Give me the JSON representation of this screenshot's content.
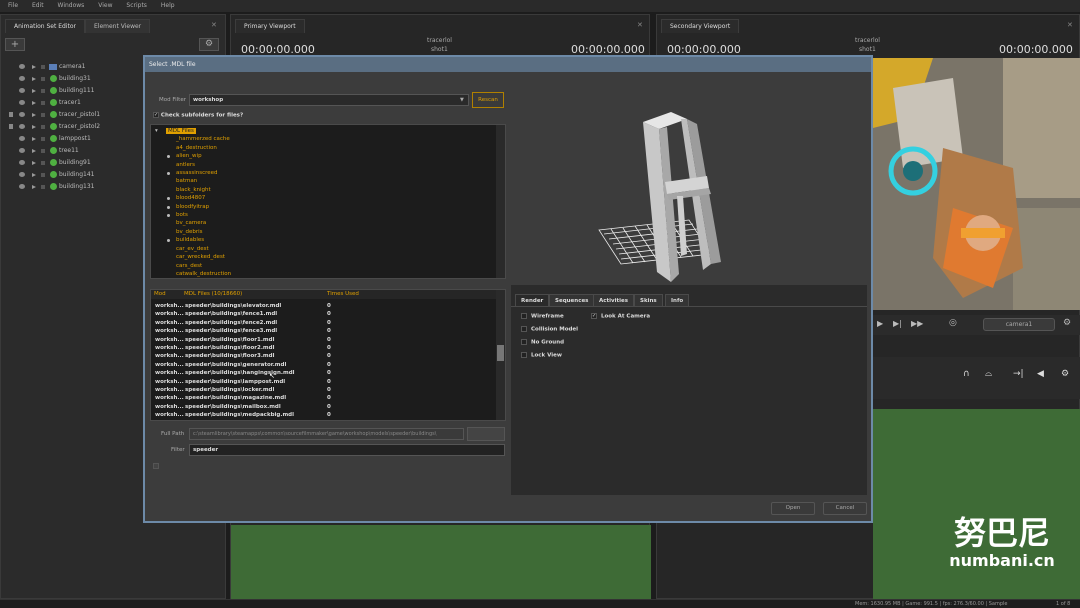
{
  "menubar": {
    "items": [
      "File",
      "Edit",
      "Windows",
      "View",
      "Scripts",
      "Help"
    ]
  },
  "left_panel": {
    "tabs": [
      "Animation Set Editor",
      "Element Viewer"
    ],
    "tree": [
      {
        "label": "camera1",
        "icon": "camera-icon"
      },
      {
        "label": "building31",
        "icon": "model-icon"
      },
      {
        "label": "building111",
        "icon": "model-icon"
      },
      {
        "label": "tracer1",
        "icon": "model-icon"
      },
      {
        "label": "tracer_pistol1",
        "icon": "model-icon",
        "locked": true
      },
      {
        "label": "tracer_pistol2",
        "icon": "model-icon",
        "locked": true
      },
      {
        "label": "lamppost1",
        "icon": "model-icon"
      },
      {
        "label": "tree11",
        "icon": "model-icon"
      },
      {
        "label": "building91",
        "icon": "model-icon"
      },
      {
        "label": "building141",
        "icon": "model-icon"
      },
      {
        "label": "building131",
        "icon": "model-icon"
      }
    ]
  },
  "primary_viewport": {
    "tab": "Primary Viewport",
    "timecode_left": "00:00:00.000",
    "shot_name": "tracerlol",
    "shot": "shot1",
    "timecode_right": "00:00:00.000"
  },
  "secondary_viewport": {
    "tab": "Secondary Viewport",
    "timecode_left": "00:00:00.000",
    "shot_name": "tracerlol",
    "shot": "shot1",
    "timecode_right": "00:00:00.000",
    "camera_dropdown": "camera1"
  },
  "dialog": {
    "title": "Select .MDL file",
    "mod_filter_label": "Mod Filter",
    "mod_filter_value": "workshop",
    "rescan_label": "Rescan",
    "check_subfolders_label": "Check subfolders for files?",
    "folders": [
      {
        "label": "MDL Files",
        "level": 0,
        "selected": true
      },
      {
        "label": "_hammerzed cache",
        "level": 1
      },
      {
        "label": "a4_destruction",
        "level": 1
      },
      {
        "label": "alien_wip",
        "level": 1,
        "bullet": true
      },
      {
        "label": "antlers",
        "level": 1
      },
      {
        "label": "assassinscreed",
        "level": 1,
        "bullet": true
      },
      {
        "label": "batman",
        "level": 1
      },
      {
        "label": "black_knight",
        "level": 1
      },
      {
        "label": "blood4807",
        "level": 1,
        "bullet": true
      },
      {
        "label": "bloodfyitrap",
        "level": 1,
        "bullet": true
      },
      {
        "label": "bots",
        "level": 1,
        "bullet": true
      },
      {
        "label": "bv_camera",
        "level": 2
      },
      {
        "label": "bv_debris",
        "level": 2
      },
      {
        "label": "buildables",
        "level": 1,
        "bullet": true
      },
      {
        "label": "car_ev_dest",
        "level": 1
      },
      {
        "label": "car_wrecked_dest",
        "level": 1
      },
      {
        "label": "cars_dest",
        "level": 1
      },
      {
        "label": "catwalk_destruction",
        "level": 1
      }
    ],
    "file_columns": {
      "mod": "Mod",
      "file": "MDL Files (10/18660)",
      "times_used": "Times Used"
    },
    "files": [
      {
        "mod": "worksh...",
        "file": "speeder\\buildings\\elevator.mdl",
        "used": "0"
      },
      {
        "mod": "worksh...",
        "file": "speeder\\buildings\\fence1.mdl",
        "used": "0"
      },
      {
        "mod": "worksh...",
        "file": "speeder\\buildings\\fence2.mdl",
        "used": "0"
      },
      {
        "mod": "worksh...",
        "file": "speeder\\buildings\\fence3.mdl",
        "used": "0"
      },
      {
        "mod": "worksh...",
        "file": "speeder\\buildings\\floor1.mdl",
        "used": "0"
      },
      {
        "mod": "worksh...",
        "file": "speeder\\buildings\\floor2.mdl",
        "used": "0"
      },
      {
        "mod": "worksh...",
        "file": "speeder\\buildings\\floor3.mdl",
        "used": "0"
      },
      {
        "mod": "worksh...",
        "file": "speeder\\buildings\\generator.mdl",
        "used": "0"
      },
      {
        "mod": "worksh...",
        "file": "speeder\\buildings\\hangingsign.mdl",
        "used": "0"
      },
      {
        "mod": "worksh...",
        "file": "speeder\\buildings\\lamppost.mdl",
        "used": "0"
      },
      {
        "mod": "worksh...",
        "file": "speeder\\buildings\\locker.mdl",
        "used": "0"
      },
      {
        "mod": "worksh...",
        "file": "speeder\\buildings\\magazine.mdl",
        "used": "0"
      },
      {
        "mod": "worksh...",
        "file": "speeder\\buildings\\mailbox.mdl",
        "used": "0"
      },
      {
        "mod": "worksh...",
        "file": "speeder\\buildings\\medpackbig.mdl",
        "used": "0"
      }
    ],
    "full_path_label": "Full Path",
    "full_path_value": "c:\\steamlibrary\\steamapps\\common\\sourcefilmmaker\\game\\workshop\\models\\speeder\\buildings\\",
    "filter_label": "Filter",
    "filter_value": "speeder",
    "preview_tabs": [
      "Render",
      "Sequences",
      "Activities",
      "Skins",
      "Info"
    ],
    "render_options": [
      {
        "label": "Wireframe",
        "checked": false
      },
      {
        "label": "Look At Camera",
        "checked": true
      },
      {
        "label": "Collision Model",
        "checked": false
      },
      {
        "label": "No Ground",
        "checked": false
      },
      {
        "label": "Lock View",
        "checked": false
      }
    ],
    "open_label": "Open",
    "cancel_label": "Cancel"
  },
  "watermark": {
    "cn": "努巴尼",
    "url": "numbani.cn"
  },
  "statusbar": {
    "text": "Mem: 1630.95 MB | Game: 991.5 | fps: 276.3/60.00 | Sample",
    "page": "1 of 8"
  },
  "colors": {
    "accent": "#e0a000",
    "green": "#4fb041",
    "timeline_green": "#3e6b36"
  }
}
